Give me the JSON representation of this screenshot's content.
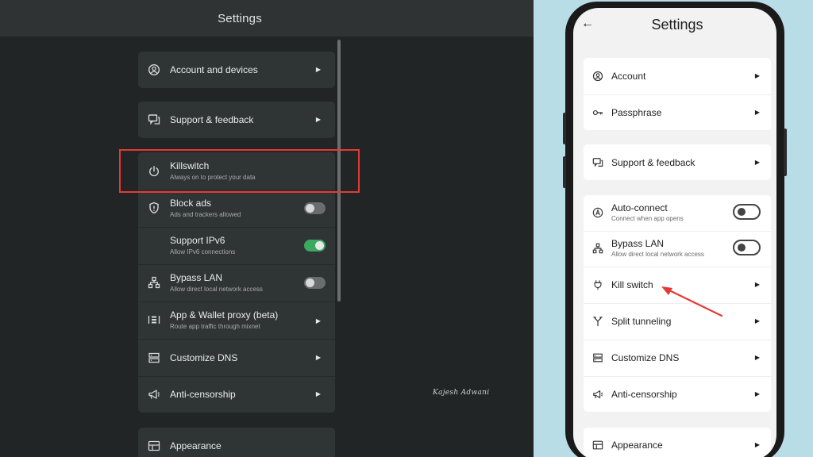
{
  "desktop": {
    "title": "Settings",
    "signature": "Kajesh Adwani",
    "groups": {
      "account": {
        "label": "Account and devices",
        "icon": "user-circle-icon"
      },
      "support": {
        "label": "Support & feedback",
        "icon": "chat-icon"
      },
      "killswitch": {
        "label": "Killswitch",
        "sublabel": "Always on to protect your data",
        "icon": "power-icon"
      },
      "block_ads": {
        "label": "Block ads",
        "sublabel": "Ads and trackers allowed",
        "icon": "shield-icon",
        "enabled": false
      },
      "ipv6": {
        "label": "Support IPv6",
        "sublabel": "Allow IPv6 connections",
        "enabled": true
      },
      "bypass_lan": {
        "label": "Bypass LAN",
        "sublabel": "Allow direct local network access",
        "icon": "network-icon",
        "enabled": false
      },
      "proxy": {
        "label": "App & Wallet proxy (beta)",
        "sublabel": "Route app traffic through mixnet",
        "icon": "proxy-icon"
      },
      "dns": {
        "label": "Customize DNS",
        "icon": "server-icon"
      },
      "censorship": {
        "label": "Anti-censorship",
        "icon": "megaphone-icon"
      },
      "appearance": {
        "label": "Appearance",
        "icon": "display-icon"
      }
    }
  },
  "mobile": {
    "title": "Settings",
    "items": {
      "account": {
        "label": "Account",
        "icon": "user-circle-icon"
      },
      "passphrase": {
        "label": "Passphrase",
        "icon": "key-icon"
      },
      "support": {
        "label": "Support & feedback",
        "icon": "chat-icon"
      },
      "auto_connect": {
        "label": "Auto-connect",
        "sublabel": "Connect when app opens",
        "icon": "letter-a-icon",
        "enabled": false
      },
      "bypass_lan": {
        "label": "Bypass LAN",
        "sublabel": "Allow direct local network access",
        "icon": "network-icon",
        "enabled": false
      },
      "kill_switch": {
        "label": "Kill switch",
        "icon": "plug-icon"
      },
      "split": {
        "label": "Split tunneling",
        "icon": "split-icon"
      },
      "dns": {
        "label": "Customize DNS",
        "icon": "server-icon"
      },
      "censorship": {
        "label": "Anti-censorship",
        "icon": "megaphone-icon"
      },
      "appearance": {
        "label": "Appearance",
        "icon": "display-icon"
      }
    }
  },
  "colors": {
    "desktop_bg": "#212526",
    "card_dark": "#2f3435",
    "toggle_on": "#3da85f",
    "highlight": "#e53935",
    "arrow": "#e53935",
    "page_bg": "#b9dde6"
  }
}
